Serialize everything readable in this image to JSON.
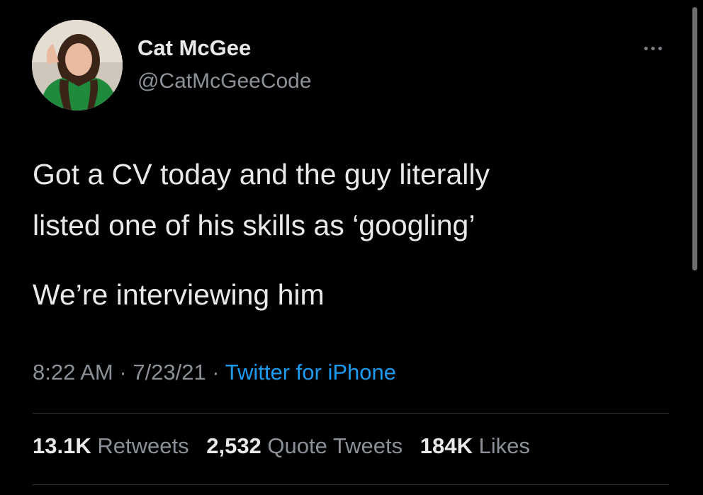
{
  "author": {
    "name": "Cat McGee",
    "handle": "@CatMcGeeCode"
  },
  "tweet": {
    "lines": [
      "Got a CV today and the guy literally",
      "listed one of his skills as ‘googling’",
      "We’re interviewing him"
    ],
    "time": "8:22 AM",
    "date": "7/23/21",
    "separator": "·",
    "source": "Twitter for iPhone"
  },
  "stats": {
    "retweets_count": "13.1K",
    "retweets_label": "Retweets",
    "quotes_count": "2,532",
    "quotes_label": "Quote Tweets",
    "likes_count": "184K",
    "likes_label": "Likes"
  },
  "icons": {
    "more": "more-options-icon"
  },
  "colors": {
    "background": "#000000",
    "primary_text": "#e7e9ea",
    "secondary_text": "#8b9197",
    "link": "#1d9bf0",
    "divider": "#2f3336"
  }
}
